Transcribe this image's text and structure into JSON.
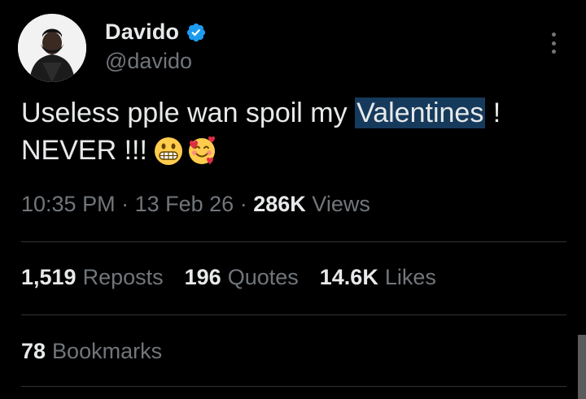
{
  "author": {
    "display_name": "Davido",
    "handle": "@davido",
    "verified": true,
    "avatar_icon": "profile-photo"
  },
  "menu_icon": "more-vertical-icon",
  "tweet": {
    "text_part1": "Useless pple wan spoil my ",
    "text_highlight": "Valentines",
    "text_part2": " !",
    "line2": "NEVER !!!",
    "emojis": [
      "grimacing-face-emoji",
      "smiling-face-with-hearts-emoji"
    ]
  },
  "meta": {
    "time": "10:35 PM",
    "separator": "·",
    "date": "13 Feb 26",
    "views_count": "286K",
    "views_label": "Views"
  },
  "stats": {
    "reposts_count": "1,519",
    "reposts_label": "Reposts",
    "quotes_count": "196",
    "quotes_label": "Quotes",
    "likes_count": "14.6K",
    "likes_label": "Likes"
  },
  "bookmarks": {
    "count": "78",
    "label": "Bookmarks"
  },
  "colors": {
    "background": "#000000",
    "primary_text": "#e7e9ea",
    "secondary_text": "#71767b",
    "verified": "#1d9bf0",
    "highlight": "#163a5c",
    "divider": "#2f3336"
  }
}
